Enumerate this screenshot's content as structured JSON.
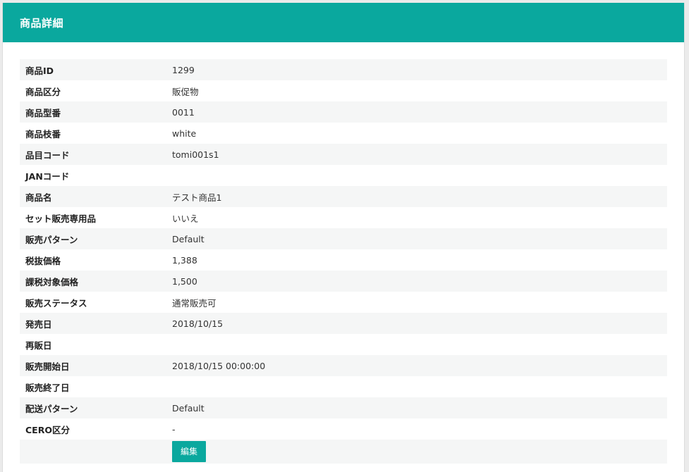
{
  "panel": {
    "title": "商品詳細"
  },
  "details": [
    {
      "label": "商品ID",
      "value": "1299"
    },
    {
      "label": "商品区分",
      "value": "販促物"
    },
    {
      "label": "商品型番",
      "value": "0011"
    },
    {
      "label": "商品枝番",
      "value": "white"
    },
    {
      "label": "品目コード",
      "value": "tomi001s1"
    },
    {
      "label": "JANコード",
      "value": ""
    },
    {
      "label": "商品名",
      "value": "テスト商品1"
    },
    {
      "label": "セット販売専用品",
      "value": "いいえ"
    },
    {
      "label": "販売パターン",
      "value": "Default"
    },
    {
      "label": "税抜価格",
      "value": "1,388"
    },
    {
      "label": "課税対象価格",
      "value": "1,500"
    },
    {
      "label": "販売ステータス",
      "value": "通常販売可"
    },
    {
      "label": "発売日",
      "value": "2018/10/15"
    },
    {
      "label": "再販日",
      "value": ""
    },
    {
      "label": "販売開始日",
      "value": "2018/10/15 00:00:00"
    },
    {
      "label": "販売終了日",
      "value": ""
    },
    {
      "label": "配送パターン",
      "value": "Default"
    },
    {
      "label": "CERO区分",
      "value": "-"
    }
  ],
  "actions": {
    "edit_label": "編集"
  },
  "colors": {
    "accent": "#0aa89e",
    "row_stripe": "#f5f6f6"
  }
}
